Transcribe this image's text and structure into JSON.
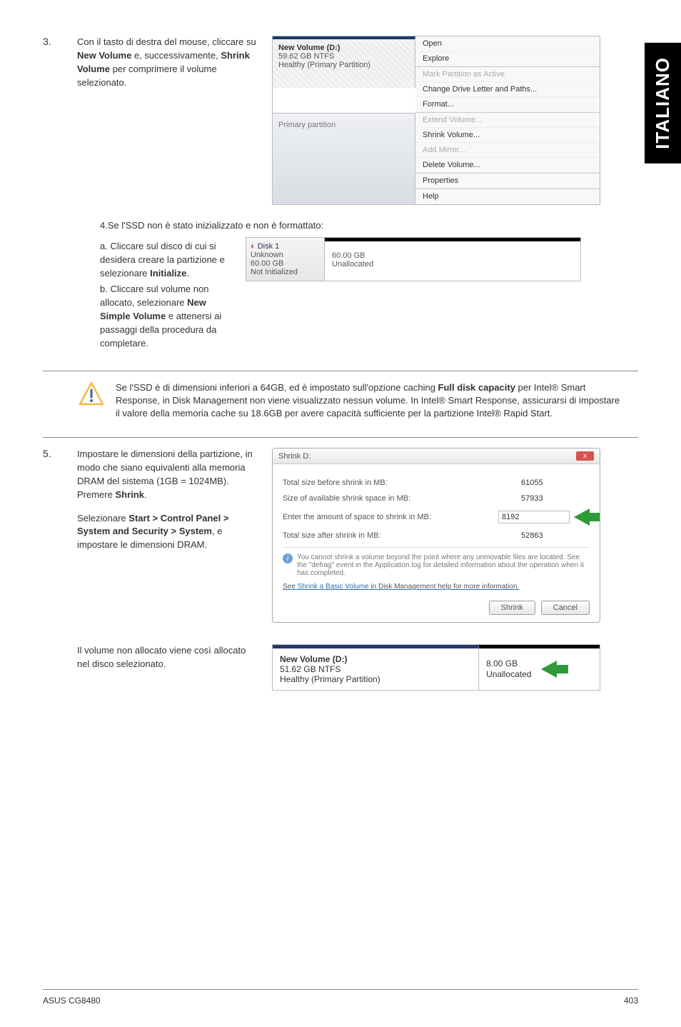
{
  "sideTab": "ITALIANO",
  "step3": {
    "num": "3.",
    "text_parts": [
      "Con il tasto di destra del mouse, cliccare su ",
      "New Volume",
      " e, successivamente, ",
      "Shrink Volume",
      " per comprimere il volume selezionato."
    ]
  },
  "ctxMenu": {
    "vol": {
      "l1": "New Volume  (D:)",
      "l2": "59.62 GB NTFS",
      "l3": "Healthy (Primary Partition)"
    },
    "primary": "Primary partition",
    "items": [
      {
        "label": "Open",
        "gray": false
      },
      {
        "label": "Explore",
        "gray": false
      },
      {
        "label": "Mark Partition as Active",
        "gray": true
      },
      {
        "label": "Change Drive Letter and Paths...",
        "gray": false
      },
      {
        "label": "Format...",
        "gray": false
      },
      {
        "label": "Extend Volume...",
        "gray": true
      },
      {
        "label": "Shrink Volume...",
        "gray": false
      },
      {
        "label": "Add Mirror...",
        "gray": true
      },
      {
        "label": "Delete Volume...",
        "gray": false
      },
      {
        "label": "Properties",
        "gray": false
      },
      {
        "label": "Help",
        "gray": false
      }
    ]
  },
  "step4": {
    "intro": "4.Se l'SSD non è stato inizializzato e non è formattato:",
    "a_parts": [
      "a. Cliccare sul disco di cui si desidera creare la partizione e selezionare ",
      "Initialize",
      "."
    ],
    "b_parts": [
      "b.   Cliccare sul volume non allocato, selezionare ",
      "New Simple Volume",
      " e attenersi ai passaggi della procedura da completare."
    ]
  },
  "disk1": {
    "title": "Disk 1",
    "unknown": "Unknown",
    "size": "60.00 GB",
    "state": "Not Initialized",
    "unalloc_size": "60.00 GB",
    "unalloc_label": "Unallocated"
  },
  "note": {
    "text_parts": [
      "Se l'SSD è di dimensioni inferiori a 64GB, ed è impostato sull'opzione caching ",
      "Full disk capacity",
      " per Intel® Smart Response, in Disk Management non viene visualizzato nessun volume. In Intel® Smart Response, assicurarsi di impostare il valore della memoria cache su 18.6GB per avere capacità sufficiente per la partizione Intel® Rapid Start."
    ]
  },
  "step5": {
    "num": "5.",
    "p1_parts": [
      "Impostare le dimensioni della partizione, in modo che siano equivalenti alla memoria DRAM del sistema (1GB = 1024MB). Premere ",
      "Shrink",
      "."
    ],
    "p2_parts": [
      "Selezionare ",
      "Start > Control Panel > System and Security > System",
      ", e impostare le dimensioni DRAM."
    ],
    "p3": "Il volume non allocato viene così allocato nel disco selezionato."
  },
  "dialog": {
    "title": "Shrink D:",
    "close": "x",
    "row1": {
      "label": "Total size before shrink in MB:",
      "val": "61055"
    },
    "row2": {
      "label": "Size of available shrink space in MB:",
      "val": "57933"
    },
    "row3": {
      "label": "Enter the amount of space to shrink in MB:",
      "val": "8192"
    },
    "row4": {
      "label": "Total size after shrink in MB:",
      "val": "52863"
    },
    "note": "You cannot shrink a volume beyond the point where any unmovable files are located. See the \"defrag\" event in the Application log for detailed information about the operation when it has completed.",
    "link_pre": "See ",
    "link": "Shrink a Basic Volume",
    "link_post": " in Disk Management help for more information.",
    "btnOk": "Shrink",
    "btnCancel": "Cancel"
  },
  "alloc": {
    "l1": "New Volume  (D:)",
    "l2": "51.62 GB NTFS",
    "l3": "Healthy (Primary Partition)",
    "r1": "8.00 GB",
    "r2": "Unallocated"
  },
  "footer": {
    "left": "ASUS CG8480",
    "right": "403"
  }
}
